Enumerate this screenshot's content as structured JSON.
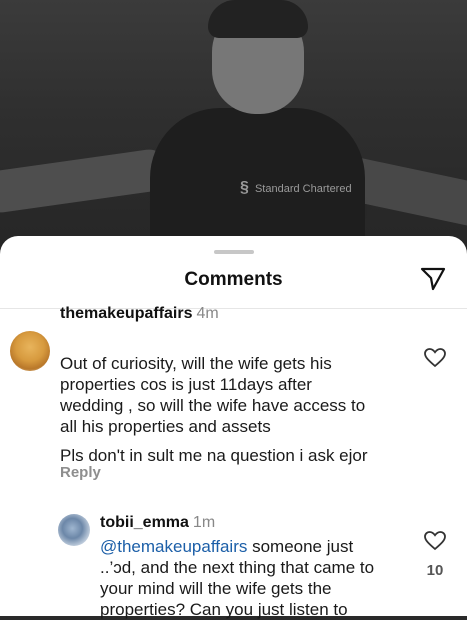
{
  "photo": {
    "sponsor_text": "Standard Chartered"
  },
  "sheet": {
    "title": "Comments",
    "share_icon": "send-icon"
  },
  "comments": [
    {
      "username": "themakeupaffairs",
      "time": "4m",
      "lines": [
        "Out of curiosity, will the wife gets his",
        "properties cos is just 11days after",
        "wedding , so will the wife have access to",
        "all his properties and assets"
      ],
      "extra_line": "Pls don't in sult me na question i ask ejor",
      "reply_label": "Reply",
      "like_icon": "heart-outline-icon"
    },
    {
      "username": "tobii_emma",
      "time": "1m",
      "mention": "@themakeupaffairs",
      "line1_rest": " someone just",
      "lines": [
        "..’ɔd, and the next thing that came to",
        "your mind will the wife gets the",
        "properties? Can you just listen to"
      ],
      "like_icon": "heart-outline-icon",
      "like_count": "10"
    }
  ],
  "colors": {
    "sheet_bg": "#ffffff",
    "mention": "#1c5fa8",
    "muted": "#8e8e8e"
  }
}
